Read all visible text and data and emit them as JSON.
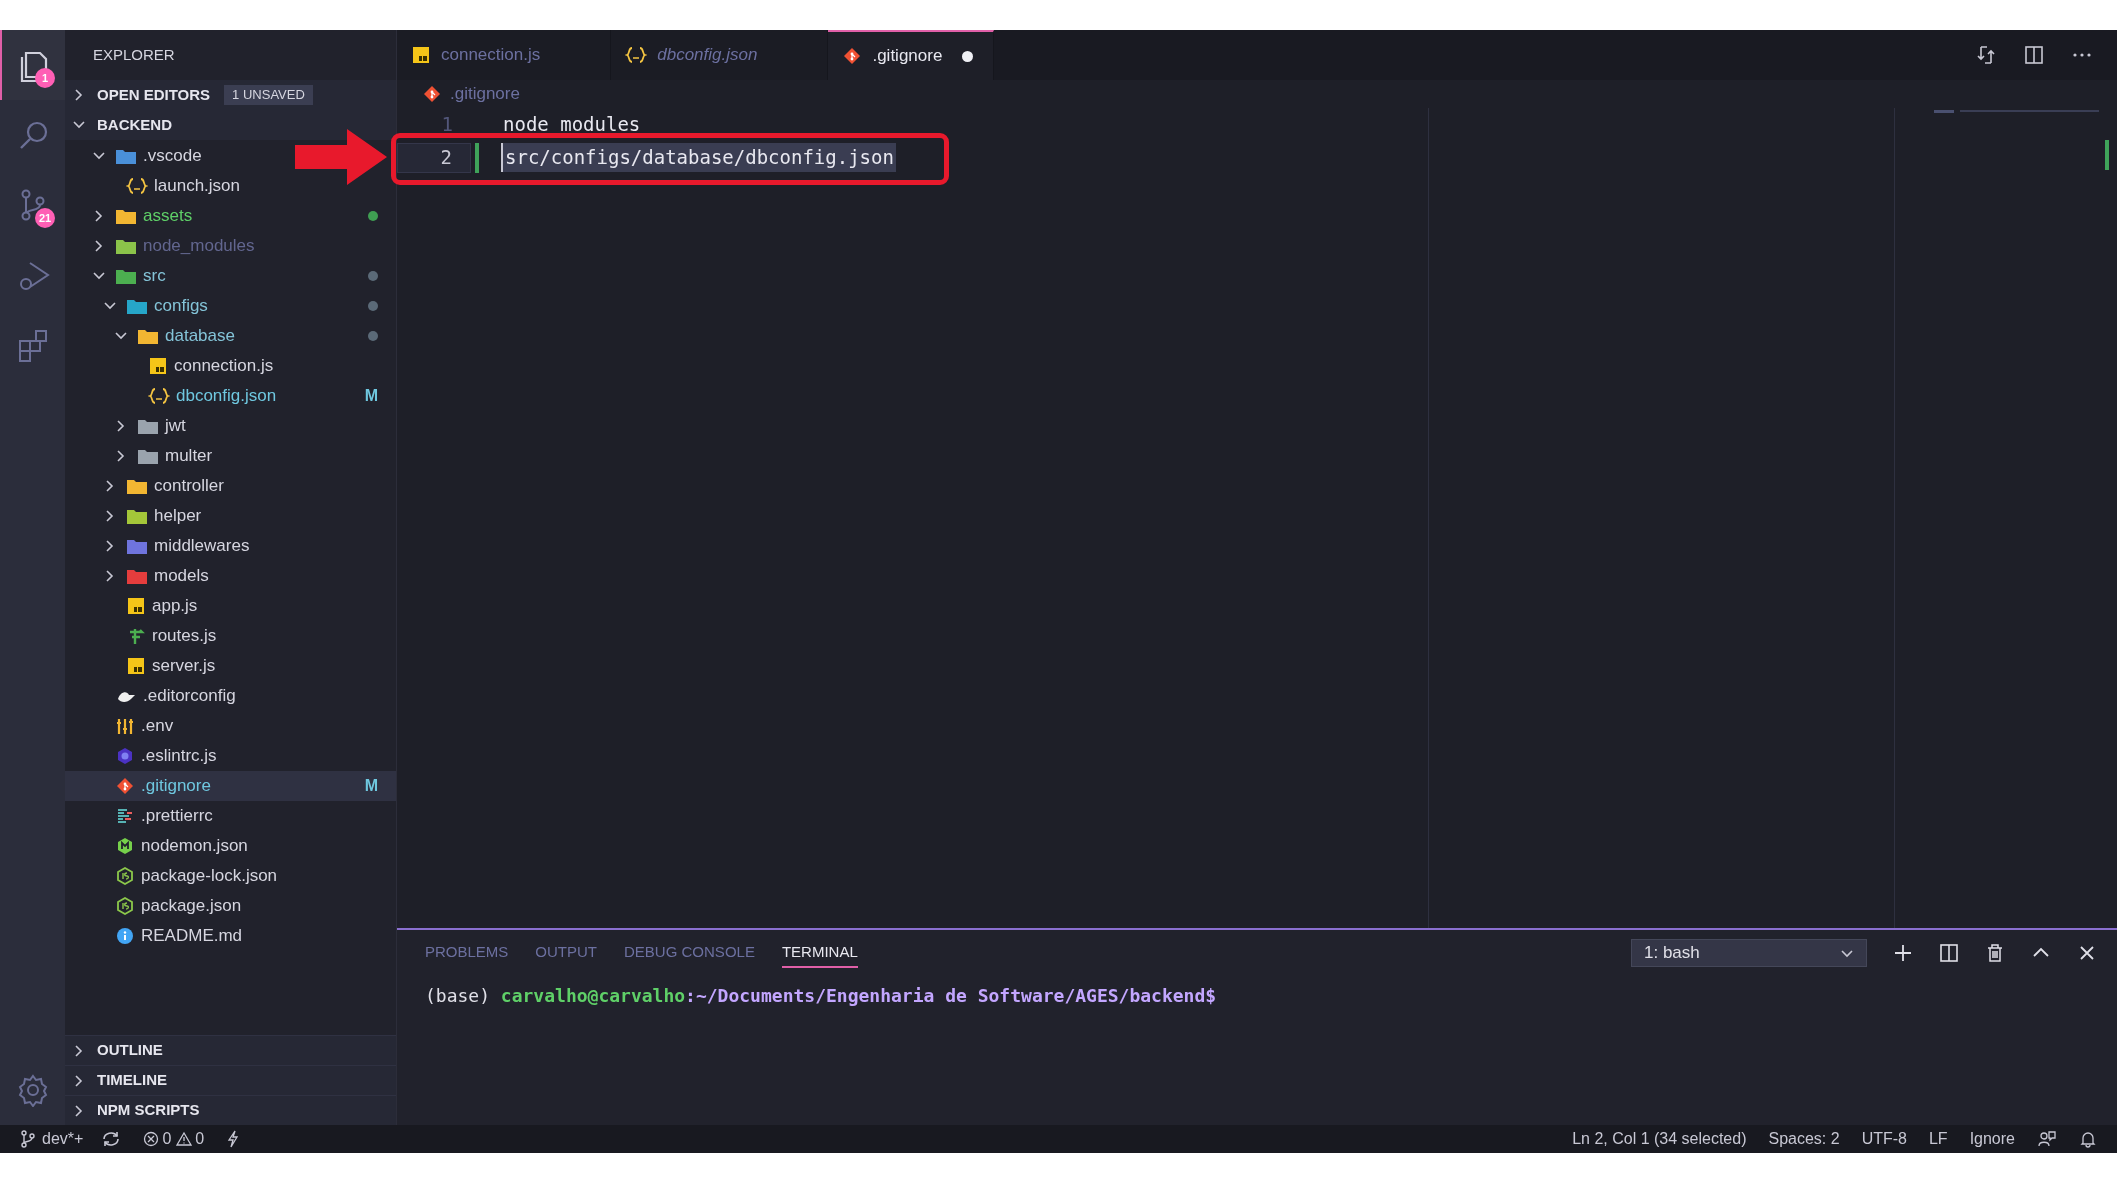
{
  "activity_bar": {
    "items": [
      {
        "kind": "files",
        "selected": true,
        "badge": "1"
      },
      {
        "kind": "search",
        "selected": false
      },
      {
        "kind": "source-control",
        "selected": false,
        "badge": "21"
      },
      {
        "kind": "run",
        "selected": false
      },
      {
        "kind": "extensions",
        "selected": false
      }
    ]
  },
  "sidebar": {
    "title": "EXPLORER",
    "open_editors": {
      "label": "OPEN EDITORS",
      "badge": "1 UNSAVED",
      "expanded": false
    },
    "folder": {
      "label": "BACKEND",
      "expanded": true
    },
    "tree": [
      {
        "name": ".vscode",
        "kind": "folder",
        "color": "#4a90d9",
        "expanded": true,
        "selected": false,
        "untracked": false,
        "ignored": false,
        "contains_changes": false,
        "children": [
          {
            "name": "launch.json",
            "kind": "json",
            "selected": false,
            "untracked": false,
            "ignored": false,
            "contains_changes": false
          }
        ]
      },
      {
        "name": "assets",
        "kind": "folder",
        "color": "#f2b632",
        "expanded": false,
        "selected": false,
        "untracked": true,
        "ignored": false,
        "contains_changes": false
      },
      {
        "name": "node_modules",
        "kind": "folder",
        "color": "#8bc34a",
        "expanded": false,
        "selected": false,
        "untracked": false,
        "ignored": true,
        "contains_changes": false
      },
      {
        "name": "src",
        "kind": "folder",
        "color": "#4caf50",
        "expanded": true,
        "selected": false,
        "untracked": false,
        "ignored": false,
        "contains_changes": true,
        "children": [
          {
            "name": "configs",
            "kind": "folder",
            "color": "#26a6c9",
            "expanded": true,
            "selected": false,
            "untracked": false,
            "ignored": false,
            "contains_changes": true,
            "children": [
              {
                "name": "database",
                "kind": "folder",
                "color": "#f2b632",
                "expanded": true,
                "selected": false,
                "untracked": false,
                "ignored": false,
                "contains_changes": true,
                "children": [
                  {
                    "name": "connection.js",
                    "kind": "js",
                    "selected": false,
                    "untracked": false,
                    "ignored": false,
                    "contains_changes": false
                  },
                  {
                    "name": "dbconfig.json",
                    "kind": "json",
                    "selected": false,
                    "untracked": false,
                    "ignored": false,
                    "contains_changes": false,
                    "badge": "M"
                  }
                ]
              },
              {
                "name": "jwt",
                "kind": "folder",
                "color": "#9aa3ad",
                "expanded": false,
                "selected": false,
                "untracked": false,
                "ignored": false,
                "contains_changes": false
              },
              {
                "name": "multer",
                "kind": "folder",
                "color": "#9aa3ad",
                "expanded": false,
                "selected": false,
                "untracked": false,
                "ignored": false,
                "contains_changes": false
              }
            ]
          },
          {
            "name": "controller",
            "kind": "folder",
            "color": "#f2b632",
            "expanded": false,
            "selected": false,
            "untracked": false,
            "ignored": false,
            "contains_changes": false
          },
          {
            "name": "helper",
            "kind": "folder",
            "color": "#a4c639",
            "expanded": false,
            "selected": false,
            "untracked": false,
            "ignored": false,
            "contains_changes": false
          },
          {
            "name": "middlewares",
            "kind": "folder",
            "color": "#6f74dd",
            "expanded": false,
            "selected": false,
            "untracked": false,
            "ignored": false,
            "contains_changes": false
          },
          {
            "name": "models",
            "kind": "folder",
            "color": "#e53d3d",
            "expanded": false,
            "selected": false,
            "untracked": false,
            "ignored": false,
            "contains_changes": false
          },
          {
            "name": "app.js",
            "kind": "js",
            "selected": false,
            "untracked": false,
            "ignored": false,
            "contains_changes": false
          },
          {
            "name": "routes.js",
            "kind": "routes",
            "selected": false,
            "untracked": false,
            "ignored": false,
            "contains_changes": false
          },
          {
            "name": "server.js",
            "kind": "js",
            "selected": false,
            "untracked": false,
            "ignored": false,
            "contains_changes": false
          }
        ]
      },
      {
        "name": ".editorconfig",
        "kind": "editorconfig",
        "selected": false,
        "untracked": false,
        "ignored": false,
        "contains_changes": false
      },
      {
        "name": ".env",
        "kind": "env",
        "selected": false,
        "untracked": false,
        "ignored": false,
        "contains_changes": false
      },
      {
        "name": ".eslintrc.js",
        "kind": "eslint",
        "selected": false,
        "untracked": false,
        "ignored": false,
        "contains_changes": false
      },
      {
        "name": ".gitignore",
        "kind": "git",
        "selected": true,
        "untracked": false,
        "ignored": false,
        "contains_changes": false,
        "badge": "M"
      },
      {
        "name": ".prettierrc",
        "kind": "prettier",
        "selected": false,
        "untracked": false,
        "ignored": false,
        "contains_changes": false
      },
      {
        "name": "nodemon.json",
        "kind": "nodemon",
        "selected": false,
        "untracked": false,
        "ignored": false,
        "contains_changes": false
      },
      {
        "name": "package-lock.json",
        "kind": "node",
        "selected": false,
        "untracked": false,
        "ignored": false,
        "contains_changes": false
      },
      {
        "name": "package.json",
        "kind": "node",
        "selected": false,
        "untracked": false,
        "ignored": false,
        "contains_changes": false
      },
      {
        "name": "README.md",
        "kind": "info",
        "selected": false,
        "untracked": false,
        "ignored": false,
        "contains_changes": false
      }
    ],
    "sections": [
      {
        "label": "OUTLINE",
        "expanded": false
      },
      {
        "label": "TIMELINE",
        "expanded": false
      },
      {
        "label": "NPM SCRIPTS",
        "expanded": false
      }
    ]
  },
  "tabs": [
    {
      "label": "connection.js",
      "kind": "js",
      "selected": false,
      "preview": false,
      "dirty": false
    },
    {
      "label": "dbconfig.json",
      "kind": "json",
      "selected": false,
      "preview": true,
      "dirty": false
    },
    {
      "label": ".gitignore",
      "kind": "git",
      "selected": true,
      "preview": false,
      "dirty": true
    }
  ],
  "breadcrumb": ".gitignore",
  "code_lines": [
    {
      "number": "1",
      "text": "node modules",
      "current": false,
      "selected": false,
      "modified": false,
      "circled": false
    },
    {
      "number": "2",
      "text": "src/configs/database/dbconfig.json",
      "current": true,
      "selected": true,
      "modified": true,
      "circled": true
    }
  ],
  "panel": {
    "tabs": [
      {
        "label": "PROBLEMS",
        "selected": false
      },
      {
        "label": "OUTPUT",
        "selected": false
      },
      {
        "label": "DEBUG CONSOLE",
        "selected": false
      },
      {
        "label": "TERMINAL",
        "selected": true
      }
    ],
    "terminal_select": "1: bash",
    "prompt": {
      "prefix": "(base) ",
      "user": "carvalho@carvalho",
      "path": ":~/Documents/Engenharia de Software/AGES/backend$"
    }
  },
  "status_bar": {
    "branch": "dev*+",
    "errors": "0",
    "warnings": "0",
    "right": [
      "Ln 2, Col 1 (34 selected)",
      "Spaces: 2",
      "UTF-8",
      "LF",
      "Ignore"
    ]
  }
}
